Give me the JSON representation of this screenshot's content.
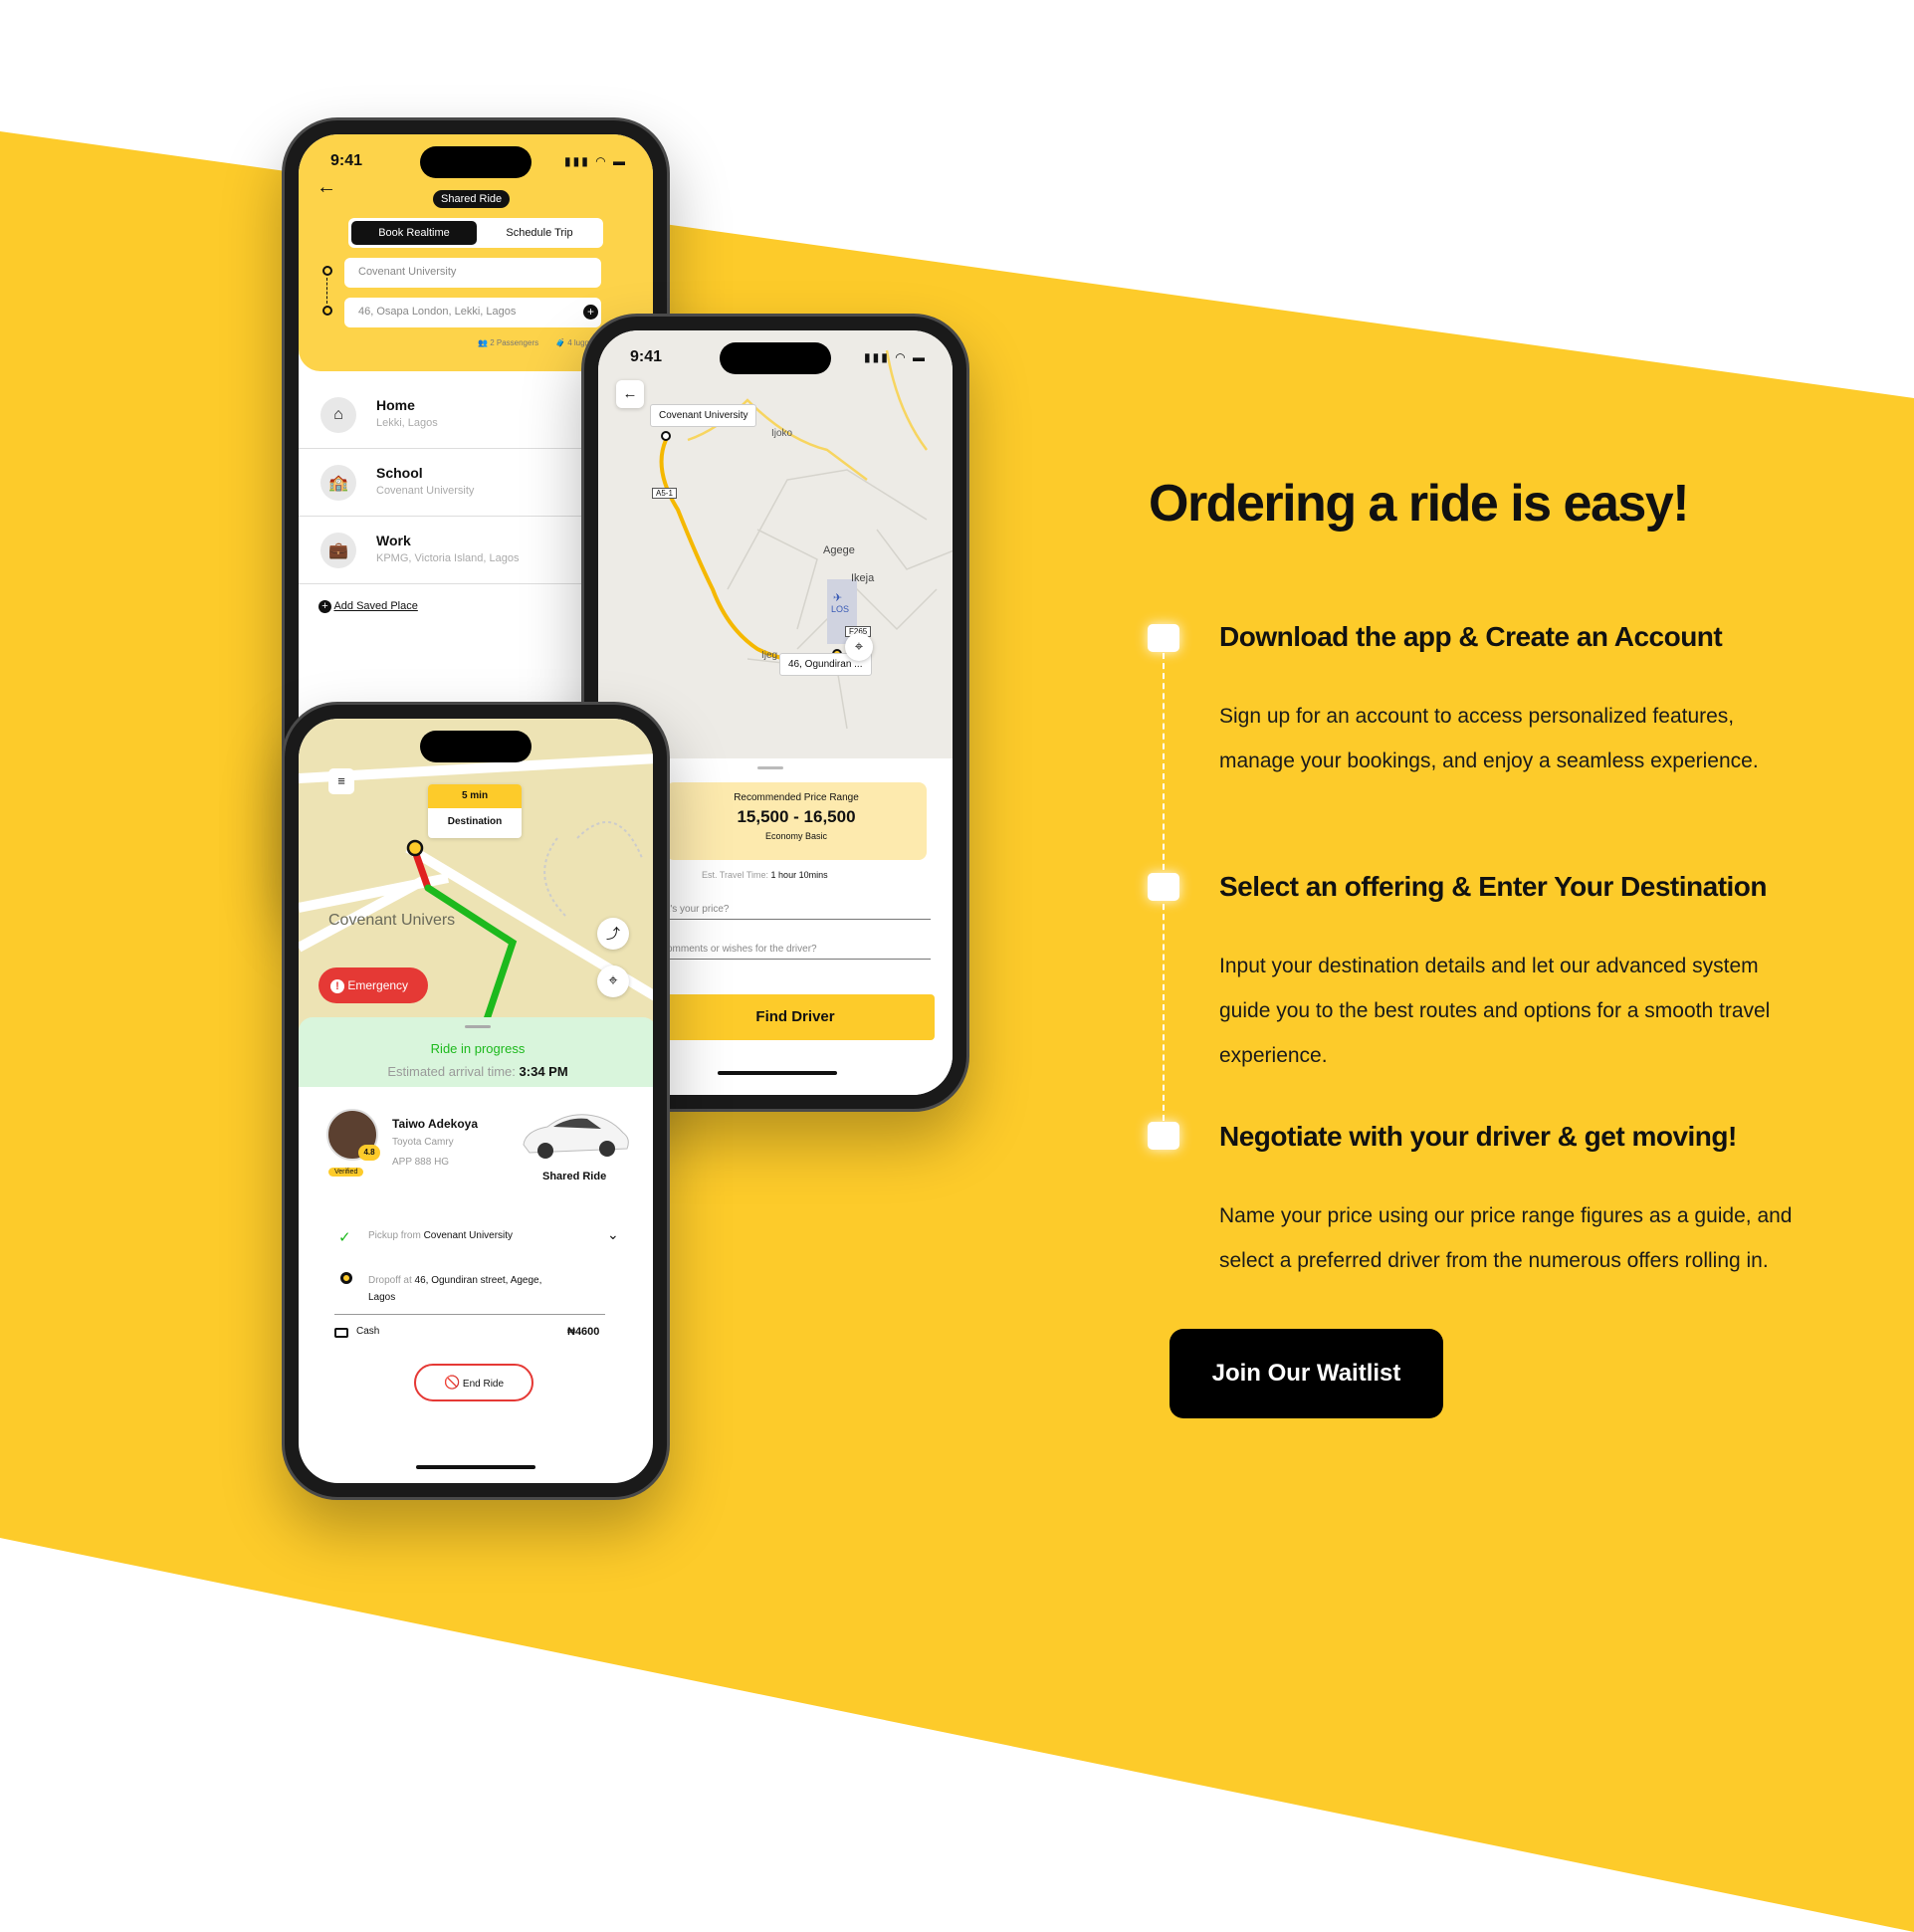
{
  "hero": {
    "heading": "Ordering a ride is easy!",
    "steps": [
      {
        "title": "Download the app & Create an Account",
        "body": "Sign up for an account to access personalized features, manage your bookings, and enjoy a seamless experience."
      },
      {
        "title": "Select an offering & Enter Your Destination",
        "body": "Input your destination details and let our advanced system guide you to the best routes and options for a smooth travel experience."
      },
      {
        "title": "Negotiate with your driver & get  moving!",
        "body": "Name your price using our price range figures as a guide, and select a preferred driver from the numerous offers rolling in."
      }
    ],
    "cta": "Join Our Waitlist"
  },
  "colors": {
    "brand_yellow": "#FDCB2A",
    "ink": "#111111",
    "progress_green": "#1DB91D",
    "emergency_red": "#E53935"
  },
  "phone1": {
    "status_time": "9:41",
    "ride_type": "Shared Ride",
    "tabs": [
      "Book Realtime",
      "Schedule Trip"
    ],
    "pickup": "Covenant University",
    "dropoff": "46, Osapa London, Lekki, Lagos",
    "passengers": "2 Passengers",
    "luggage": "4 luggage",
    "places": [
      {
        "name": "Home",
        "sub": "Lekki, Lagos",
        "icon": "home-icon"
      },
      {
        "name": "School",
        "sub": "Covenant University",
        "icon": "school-icon"
      },
      {
        "name": "Work",
        "sub": "KPMG, Victoria Island, Lagos",
        "icon": "briefcase-icon"
      }
    ],
    "add_place": "Add Saved Place"
  },
  "phone2": {
    "status_time": "9:41",
    "map_labels": {
      "origin": "Covenant University",
      "ijoko": "Ijoko",
      "agege": "Agege",
      "ikeja": "Ikeja",
      "los": "LOS",
      "a51": "A5-1",
      "f265": "F265",
      "ijeg": "Ijeg",
      "destination": "46, Ogundiran ..."
    },
    "price_title": "Recommended Price Range",
    "price_range": "15,500 - 16,500",
    "price_class": "Economy Basic",
    "travel_label": "Est. Travel Time:",
    "travel_time": "1 hour 10mins",
    "price_placeholder": "at's your price?",
    "comments_placeholder": "comments or wishes for the driver?",
    "find_driver": "Find Driver"
  },
  "phone3": {
    "eta_min": "5 min",
    "eta_label": "Destination",
    "map_place": "Covenant Univers",
    "emergency": "Emergency",
    "status": "Ride in progress",
    "arrival_label": "Estimated arrival time:",
    "arrival_time": "3:34 PM",
    "driver": {
      "name": "Taiwo Adekoya",
      "car": "Toyota Camry",
      "plate": "APP 888 HG",
      "rating": "4.8",
      "verified": "Verified"
    },
    "ride_label": "Shared Ride",
    "pickup_prefix": "Pickup from",
    "pickup": "Covenant University",
    "dropoff_prefix": "Dropoff at",
    "dropoff": "46, Ogundiran street, Agege,",
    "dropoff_city": "Lagos",
    "payment": "Cash",
    "fare": "₦4600",
    "end_ride": "End Ride"
  }
}
